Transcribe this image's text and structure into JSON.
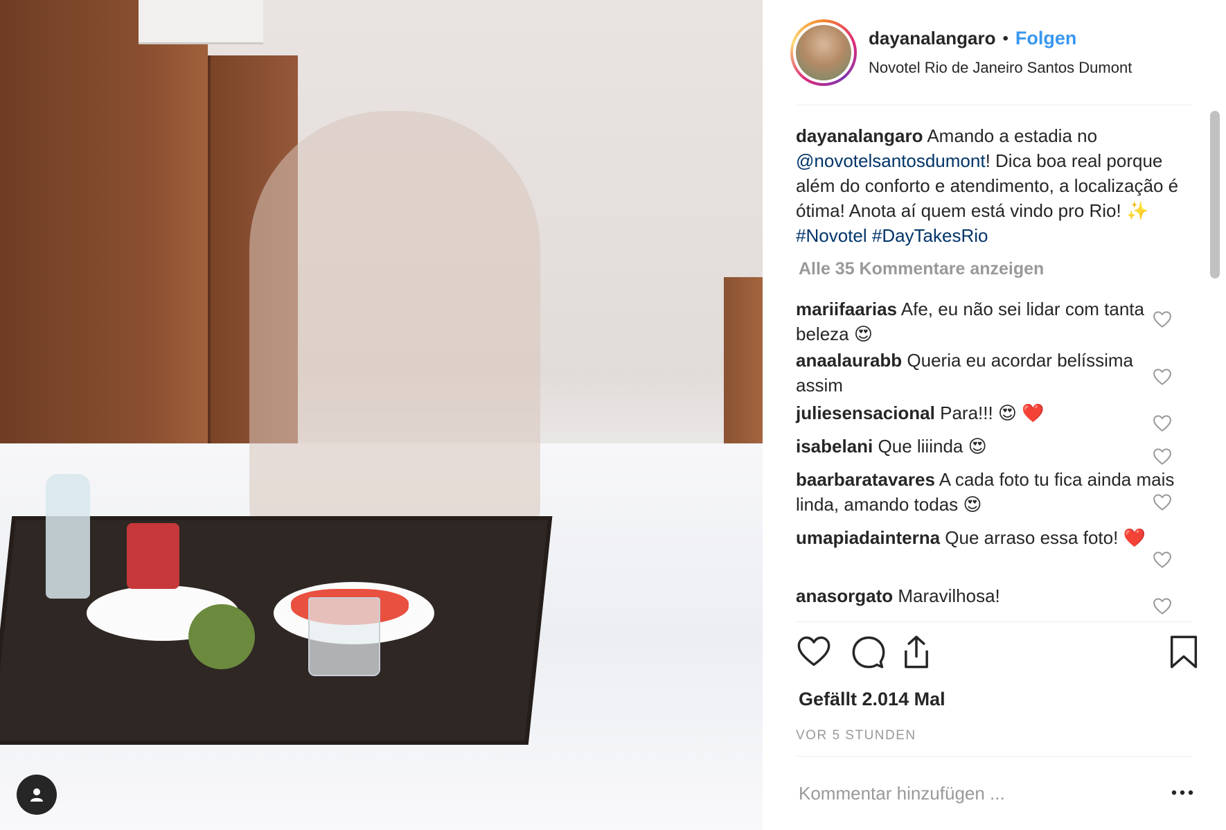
{
  "post": {
    "username": "dayanalangaro",
    "separator": "•",
    "follow_label": "Folgen",
    "location": "Novotel Rio de Janeiro Santos Dumont"
  },
  "caption": {
    "username": "dayanalangaro",
    "text_1": "Amando a estadia no",
    "mention": "@novotelsantosdumont",
    "text_2": "! Dica boa real porque além do conforto e atendimento, a localização é ótima! Anota aí quem está vindo pro Rio! ✨ ",
    "hashtag_1": "#Novotel",
    "hashtag_2": "#DayTakesRio"
  },
  "view_all_comments": "Alle 35 Kommentare anzeigen",
  "comments": [
    {
      "username": "mariifaarias",
      "text": "Afe, eu não sei lidar com tanta beleza 😍"
    },
    {
      "username": "anaalaurabb",
      "text": "Queria eu acordar belíssima assim"
    },
    {
      "username": "juliesensacional",
      "text": "Para!!! 😍 ❤️"
    },
    {
      "username": "isabelani",
      "text": "Que liiinda 😍"
    },
    {
      "username": "baarbaratavares",
      "text": "A cada foto tu fica ainda mais linda, amando todas 😍"
    },
    {
      "username": "umapiadainterna",
      "text": "Que arraso essa foto! ❤️"
    },
    {
      "username": "anasorgato",
      "text": "Maravilhosa!"
    }
  ],
  "likes_label": "Gefällt 2.014 Mal",
  "timestamp": "VOR 5 STUNDEN",
  "comment_input": {
    "placeholder": "Kommentar hinzufügen ..."
  },
  "icons": {
    "like": "heart-icon",
    "comment": "comment-bubble-icon",
    "share": "share-icon",
    "save": "bookmark-icon",
    "more": "more-options-icon",
    "user_tag": "user-tag-icon"
  },
  "colors": {
    "link_blue": "#3897f0",
    "mention_blue": "#003569",
    "muted": "#999999",
    "text": "#262626"
  }
}
